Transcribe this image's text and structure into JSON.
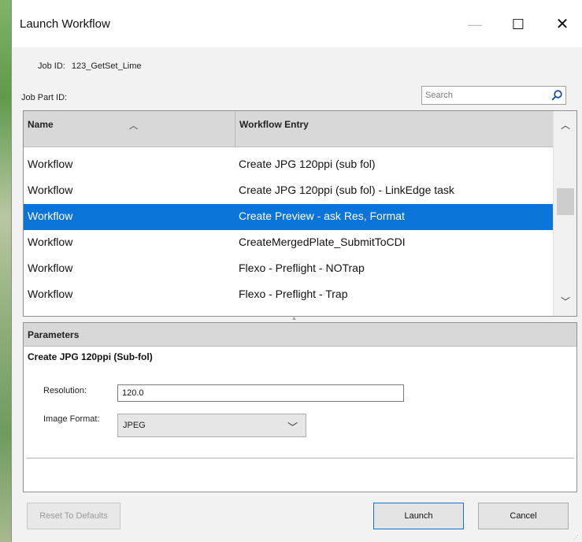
{
  "window": {
    "title": "Launch Workflow",
    "controls": {
      "minimize": "—",
      "maximize": "☐",
      "close": "✕"
    }
  },
  "job": {
    "id_label": "Job ID:",
    "id_value": "123_GetSet_Lime",
    "part_label": "Job Part ID:"
  },
  "search": {
    "placeholder": "Search",
    "value": ""
  },
  "table": {
    "columns": [
      "Name",
      "Workflow Entry"
    ],
    "sorted_column": "Name",
    "rows": [
      {
        "name": "Workflow",
        "entry": "Create JPG 120ppi (sub fol)",
        "selected": false
      },
      {
        "name": "Workflow",
        "entry": "Create JPG 120ppi (sub fol) - LinkEdge task",
        "selected": false
      },
      {
        "name": "Workflow",
        "entry": "Create Preview - ask Res, Format",
        "selected": true
      },
      {
        "name": "Workflow",
        "entry": "CreateMergedPlate_SubmitToCDI",
        "selected": false
      },
      {
        "name": "Workflow",
        "entry": "Flexo - Preflight - NOTrap",
        "selected": false
      },
      {
        "name": "Workflow",
        "entry": "Flexo - Preflight - Trap",
        "selected": false
      }
    ]
  },
  "parameters": {
    "header": "Parameters",
    "workflow_title": "Create JPG 120ppi (Sub-fol)",
    "resolution_label": "Resolution:",
    "resolution_value": "120.0",
    "image_format_label": "Image Format:",
    "image_format_value": "JPEG"
  },
  "buttons": {
    "reset": "Reset To Defaults",
    "launch": "Launch",
    "cancel": "Cancel"
  },
  "colors": {
    "selection": "#0a74d8",
    "header_bg": "#d8d8d8",
    "dialog_bg": "#f2f2f2"
  },
  "icons": {
    "search": "search-icon",
    "sort": "sort-ascending-icon",
    "dropdown": "chevron-down-icon",
    "scroll_up": "chevron-up-icon",
    "scroll_down": "chevron-down-icon"
  }
}
